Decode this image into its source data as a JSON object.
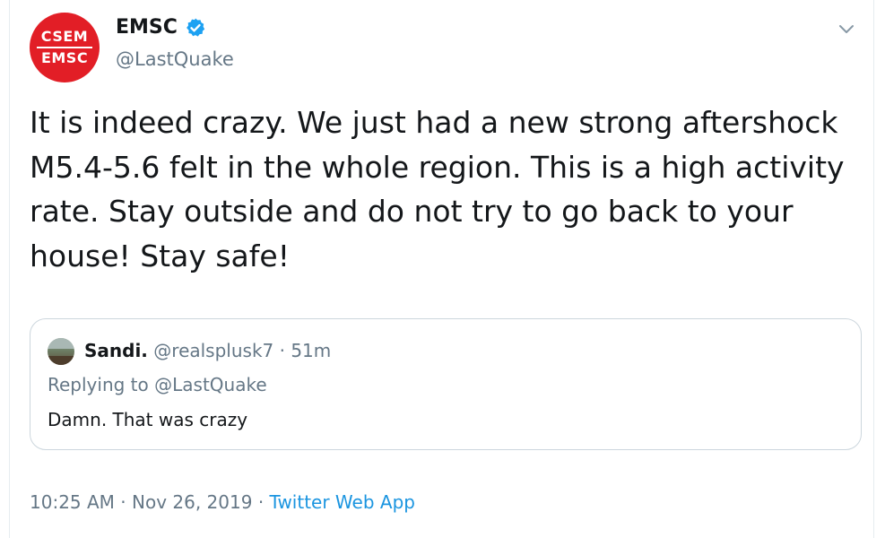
{
  "tweet": {
    "avatar_top": "CSEM",
    "avatar_bottom": "EMSC",
    "display_name": "EMSC",
    "handle": "@LastQuake",
    "text": "It is indeed crazy. We just had a new strong aftershock M5.4-5.6 felt in the whole region. This is a high activity rate. Stay outside and do not try to go back to your house! Stay safe!",
    "verified": true
  },
  "quote": {
    "name": "Sandi.",
    "handle_time": "@realsplusk7 · 51m",
    "replying_prefix": "Replying to ",
    "replying_handle": "@LastQuake",
    "text": "Damn. That was crazy"
  },
  "footer": {
    "time": "10:25 AM · Nov 26, 2019 · ",
    "app": "Twitter Web App"
  },
  "colors": {
    "brand_red": "#e21e26",
    "verified_blue": "#1da1f2",
    "link_blue": "#1b95e0",
    "muted": "#657786"
  }
}
